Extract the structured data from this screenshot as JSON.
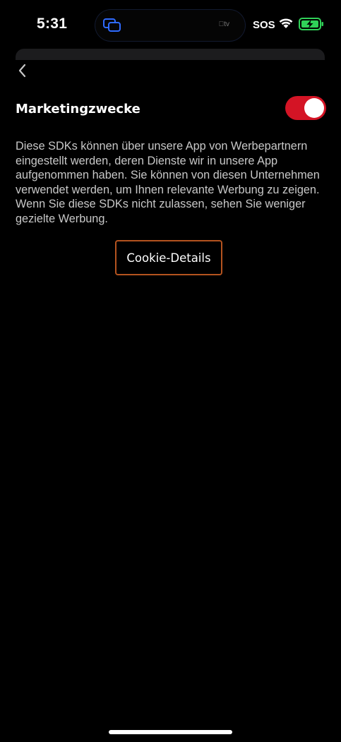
{
  "status_bar": {
    "time": "5:31",
    "island_label": "tv",
    "sos": "SOS"
  },
  "section": {
    "title": "Marketingzwecke",
    "toggle_on": true,
    "description": "Diese SDKs können über unsere App von Werbepartnern eingestellt werden, deren Dienste wir in unsere App aufgenommen haben. Sie können von diesen Unternehmen verwendet werden, um Ihnen relevante Werbung zu zeigen. Wenn Sie diese SDKs nicht zulassen, sehen Sie weniger gezielte Werbung."
  },
  "actions": {
    "cookie_details_label": "Cookie-Details"
  },
  "colors": {
    "toggle_active": "#d41425",
    "button_border": "#b4531f",
    "battery_charging": "#30d158"
  }
}
